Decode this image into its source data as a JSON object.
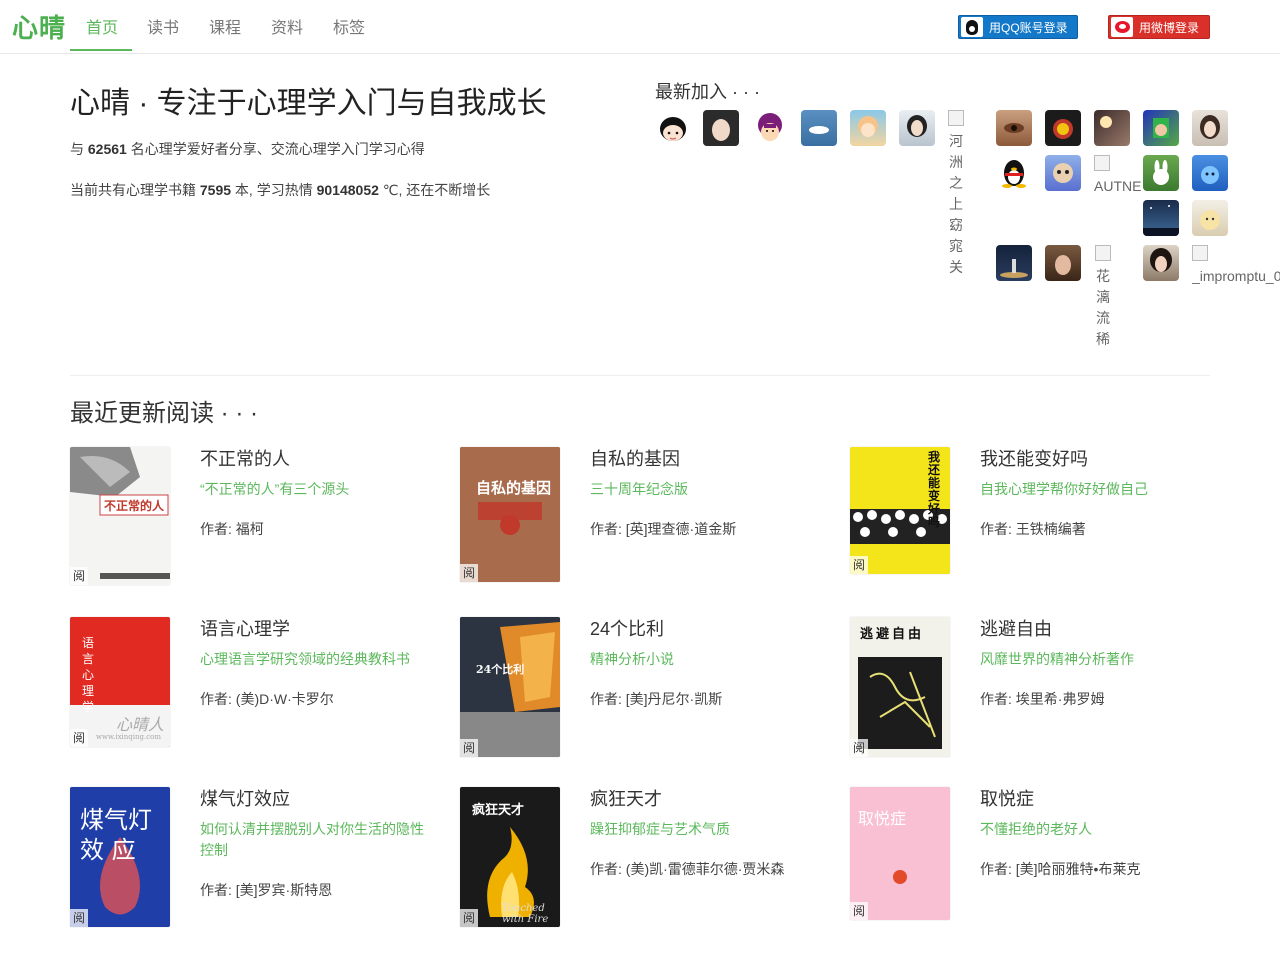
{
  "nav": {
    "logo": "心晴",
    "items": [
      "首页",
      "读书",
      "课程",
      "资料",
      "标签"
    ],
    "qq_login": "用QQ账号登录",
    "weibo_login": "用微博登录"
  },
  "hero": {
    "title": "心晴 · 专注于心理学入门与自我成长",
    "line1_pre": "与 ",
    "line1_num": "62561",
    "line1_post": " 名心理学爱好者分享、交流心理学入门学习心得",
    "line2_pre": "当前共有心理学书籍 ",
    "line2_books": "7595",
    "line2_mid": " 本, 学习热情 ",
    "line2_heat": "90148052",
    "line2_post": " ℃, 还在不断增长"
  },
  "members": {
    "title": "最新加入 · · ·",
    "broken": [
      "河洲之上窈窕关",
      "AUTNE",
      "花漓流稀",
      "_impromptu_0"
    ]
  },
  "recent": {
    "title": "最近更新阅读 · · ·",
    "read_badge": "阅",
    "books": [
      {
        "title": "不正常的人",
        "subtitle": "“不正常的人”有三个源头",
        "author": "作者: 福柯"
      },
      {
        "title": "自私的基因",
        "subtitle": "三十周年纪念版",
        "author": "作者: [英]理查德·道金斯"
      },
      {
        "title": "我还能变好吗",
        "subtitle": "自我心理学帮你好好做自己",
        "author": "作者: 王铁楠编著"
      },
      {
        "title": "语言心理学",
        "subtitle": "心理语言学研究领域的经典教科书",
        "author": "作者: (美)D·W·卡罗尔"
      },
      {
        "title": "24个比利",
        "subtitle": "精神分析小说",
        "author": "作者: [美]丹尼尔·凯斯"
      },
      {
        "title": "逃避自由",
        "subtitle": "风靡世界的精神分析著作",
        "author": "作者: 埃里希·弗罗姆"
      },
      {
        "title": "煤气灯效应",
        "subtitle": "如何认清并摆脱别人对你生活的隐性控制",
        "author": "作者: [美]罗宾·斯特恩"
      },
      {
        "title": "疯狂天才",
        "subtitle": "躁狂抑郁症与艺术气质",
        "author": "作者: (美)凯·雷德菲尔德·贾米森"
      },
      {
        "title": "取悦症",
        "subtitle": "不懂拒绝的老好人",
        "author": "作者: [美]哈丽雅特•布莱克"
      }
    ]
  },
  "covers": {
    "c1": "不正常的人",
    "c2": "自私的基因",
    "c3": "我还能变好吗",
    "c4": "语言心理学",
    "c4_small": "心晴人",
    "c4_url": "www.ixinqing.com",
    "c5": "24个比利",
    "c6": "逃避自由",
    "c7a": "煤气灯",
    "c7b": "效 应",
    "c8": "疯狂天才",
    "c8_en": "Touched with Fire",
    "c9": "取悦症"
  }
}
